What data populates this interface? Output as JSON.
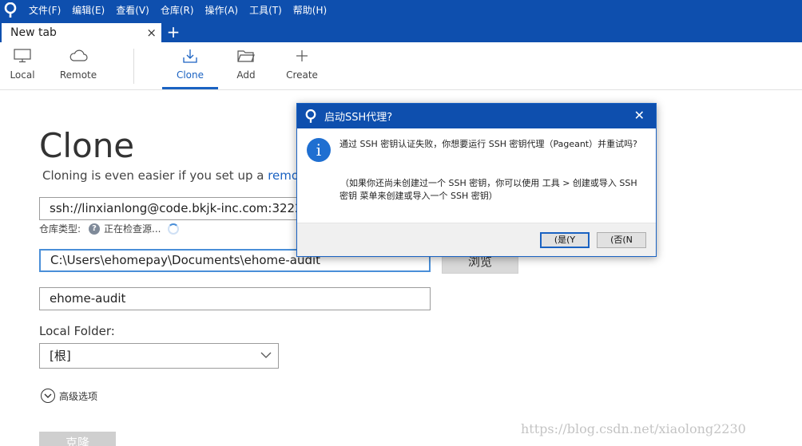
{
  "menubar": {
    "items": [
      "文件(F)",
      "编辑(E)",
      "查看(V)",
      "仓库(R)",
      "操作(A)",
      "工具(T)",
      "帮助(H)"
    ]
  },
  "tabs": {
    "current": "New tab",
    "close_glyph": "×",
    "add_glyph": "+"
  },
  "toolbar": {
    "local": "Local",
    "remote": "Remote",
    "clone": "Clone",
    "add": "Add",
    "create": "Create"
  },
  "clone": {
    "title": "Clone",
    "subtitle_prefix": "Cloning is even easier if you set up a ",
    "subtitle_link": "remote",
    "source_url": "ssh://linxianlong@code.bkjk-inc.com:3222",
    "repo_type_label": "仓库类型:",
    "repo_type_status": "正在检查源...",
    "destination_path": "C:\\Users\\ehomepay\\Documents\\ehome-audit",
    "browse_label": "浏览",
    "name": "ehome-audit",
    "local_folder_label": "Local Folder:",
    "local_folder_value": "[根]",
    "advanced_label": "高级选项",
    "clone_button": "克隆"
  },
  "dialog": {
    "title": "启动SSH代理?",
    "message": "通过 SSH 密钥认证失败，你想要运行 SSH 密钥代理（Pageant）并重试吗?",
    "note": "（如果你还尚未创建过一个 SSH 密钥，你可以使用 工具 > 创建或导入 SSH 密钥 菜单来创建或导入一个 SSH 密钥）",
    "yes_label": "(是(Y",
    "no_label": "(否(N"
  },
  "watermark": "https://blog.csdn.net/xiaolong2230",
  "colors": {
    "brand_blue": "#0e4fae",
    "accent_blue": "#1a62c2"
  }
}
